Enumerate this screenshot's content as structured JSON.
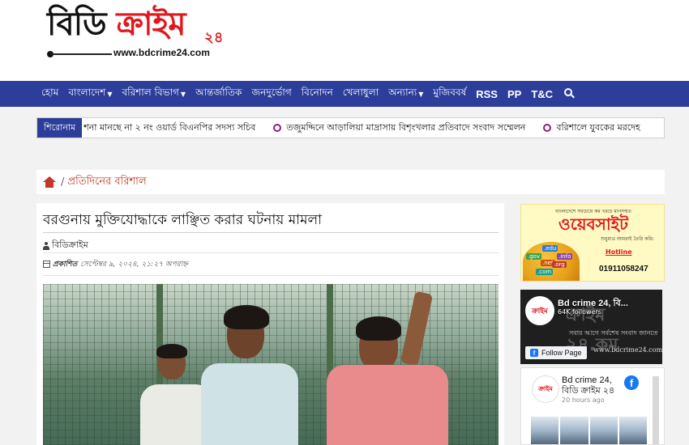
{
  "header": {
    "logo_main": "বিডি ",
    "logo_accent": "ক্রাইম",
    "logo_number": "২৪",
    "logo_url": "www.bdcrime24.com"
  },
  "nav": {
    "items": [
      {
        "label": "হোম"
      },
      {
        "label": "বাংলাদেশ"
      },
      {
        "label": "বরিশাল বিভাগ"
      },
      {
        "label": "আন্তর্জাতিক"
      },
      {
        "label": "জনদুর্ভোগ"
      },
      {
        "label": "বিনোদন"
      },
      {
        "label": "খেলাধুলা"
      },
      {
        "label": "অন্যান্য"
      },
      {
        "label": "মুজিববর্ষ"
      },
      {
        "label": "RSS"
      },
      {
        "label": "PP"
      },
      {
        "label": "T&C"
      }
    ],
    "search_icon": "search-icon"
  },
  "ticker": {
    "label": "শিরোনাম",
    "items": [
      "শনা মানছে না ২ নং ওয়ার্ড বিএনপির সদস্য সচিব",
      "তজুমদ্দিনে আড়ালিয়া মাদ্রাসায় বিশৃংখলার প্রতিবাদে সংবাদ সম্মেলন",
      "বরিশালে যুবকের মরদেহ"
    ]
  },
  "breadcrumb": {
    "home_icon": "home-icon",
    "separator": "/",
    "current": "প্রতিদিনের বরিশাল"
  },
  "article": {
    "title": "বরগুনায় মুক্তিযোদ্ধাকে লাঞ্ছিত করার ঘটনায় মামলা",
    "author": "বিডিক্রাইম",
    "published_label": "প্রকাশিত",
    "published_date": "সেপ্টেম্বর ৯, ২০২৪, ২১:২৭ অপরাহ্ন"
  },
  "sidebar": {
    "ad": {
      "top_text": "বাংলাদেশে সবচেয়ে কম খরচে মানসম্মত",
      "title": "ওয়েবসাইট",
      "sub_text": "শুধুমাত্র আমরাই তৈরি করি।",
      "chips": [
        ".edu",
        ".gov",
        ".info",
        ".net",
        ".org",
        ".com"
      ],
      "hotline_label": "Hotline",
      "phone": "01911058247"
    },
    "facebook_banner": {
      "page_name": "Bd crime 24, বি...",
      "followers": "64K followers",
      "cover_text": "ক্রাইম ২৪.কম",
      "tagline": "সবার আগে সর্বশেষ সংবাদ জানতে",
      "url": "www.bdcrime24.com",
      "follow_label": "Follow Page",
      "avatar_text": "ক্রাইম"
    },
    "facebook_feed": {
      "name_line1": "Bd crime 24,",
      "name_line2": "বিডি ক্রাইম ২৪",
      "time": "20 hours ago",
      "avatar_text": "ক্রাইম"
    }
  },
  "colors": {
    "nav_bg": "#2c3e9a",
    "brand_red": "#e0181e",
    "ticker_bullet": "#8e1f7a",
    "facebook_blue": "#1877f2"
  }
}
